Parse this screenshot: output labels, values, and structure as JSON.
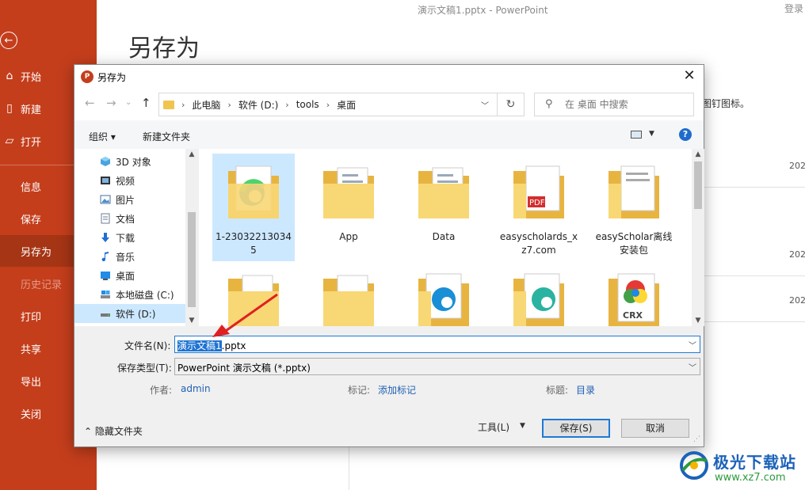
{
  "app": {
    "window_title": "演示文稿1.pptx  -  PowerPoint",
    "login": "登录",
    "page_title": "另存为",
    "right_hint": "图钉图标。",
    "years": [
      "202",
      "202",
      "202"
    ]
  },
  "sidebar": {
    "back_icon": "arrow-left-icon",
    "items": [
      {
        "label": "开始",
        "icon": "home-icon"
      },
      {
        "label": "新建",
        "icon": "new-doc-icon"
      },
      {
        "label": "打开",
        "icon": "open-folder-icon"
      },
      {
        "label": "信息"
      },
      {
        "label": "保存"
      },
      {
        "label": "另存为",
        "active": true
      },
      {
        "label": "历史记录",
        "disabled": true
      },
      {
        "label": "打印"
      },
      {
        "label": "共享"
      },
      {
        "label": "导出"
      },
      {
        "label": "关闭"
      }
    ]
  },
  "dialog": {
    "title": "另存为",
    "close": "✕",
    "breadcrumb": [
      "此电脑",
      "软件 (D:)",
      "tools",
      "桌面"
    ],
    "search_placeholder": "在 桌面 中搜索",
    "toolbar": {
      "organize": "组织 ▾",
      "new_folder": "新建文件夹",
      "help": "?"
    },
    "tree": [
      {
        "label": "3D 对象",
        "icon": "3d-objects-icon"
      },
      {
        "label": "视频",
        "icon": "video-icon"
      },
      {
        "label": "图片",
        "icon": "pictures-icon"
      },
      {
        "label": "文档",
        "icon": "documents-icon"
      },
      {
        "label": "下载",
        "icon": "downloads-icon"
      },
      {
        "label": "音乐",
        "icon": "music-icon"
      },
      {
        "label": "桌面",
        "icon": "desktop-icon"
      },
      {
        "label": "本地磁盘 (C:)",
        "icon": "drive-icon"
      },
      {
        "label": "软件 (D:)",
        "icon": "drive-icon",
        "selected": true
      }
    ],
    "files": [
      {
        "name": "1-230322130345",
        "selected": true
      },
      {
        "name": "App"
      },
      {
        "name": "Data"
      },
      {
        "name": "easyscholards_xz7.com"
      },
      {
        "name": "easyScholar离线安装包"
      }
    ],
    "filename_label": "文件名(N):",
    "filename_selected": "演示文稿1",
    "filename_rest": ".pptx",
    "filetype_label": "保存类型(T):",
    "filetype_value": "PowerPoint 演示文稿 (*.pptx)",
    "author_label": "作者:",
    "author_value": "admin",
    "tags_label": "标记:",
    "tags_value": "添加标记",
    "title_label": "标题:",
    "title_value": "目录",
    "hide_folders": "隐藏文件夹",
    "tools": "工具(L)",
    "save": "保存(S)",
    "cancel": "取消"
  },
  "watermark": {
    "name": "极光下载站",
    "url": "www.xz7.com"
  },
  "colors": {
    "accent": "#c43e1c",
    "selection": "#cce8ff",
    "link": "#1f5fb3"
  }
}
